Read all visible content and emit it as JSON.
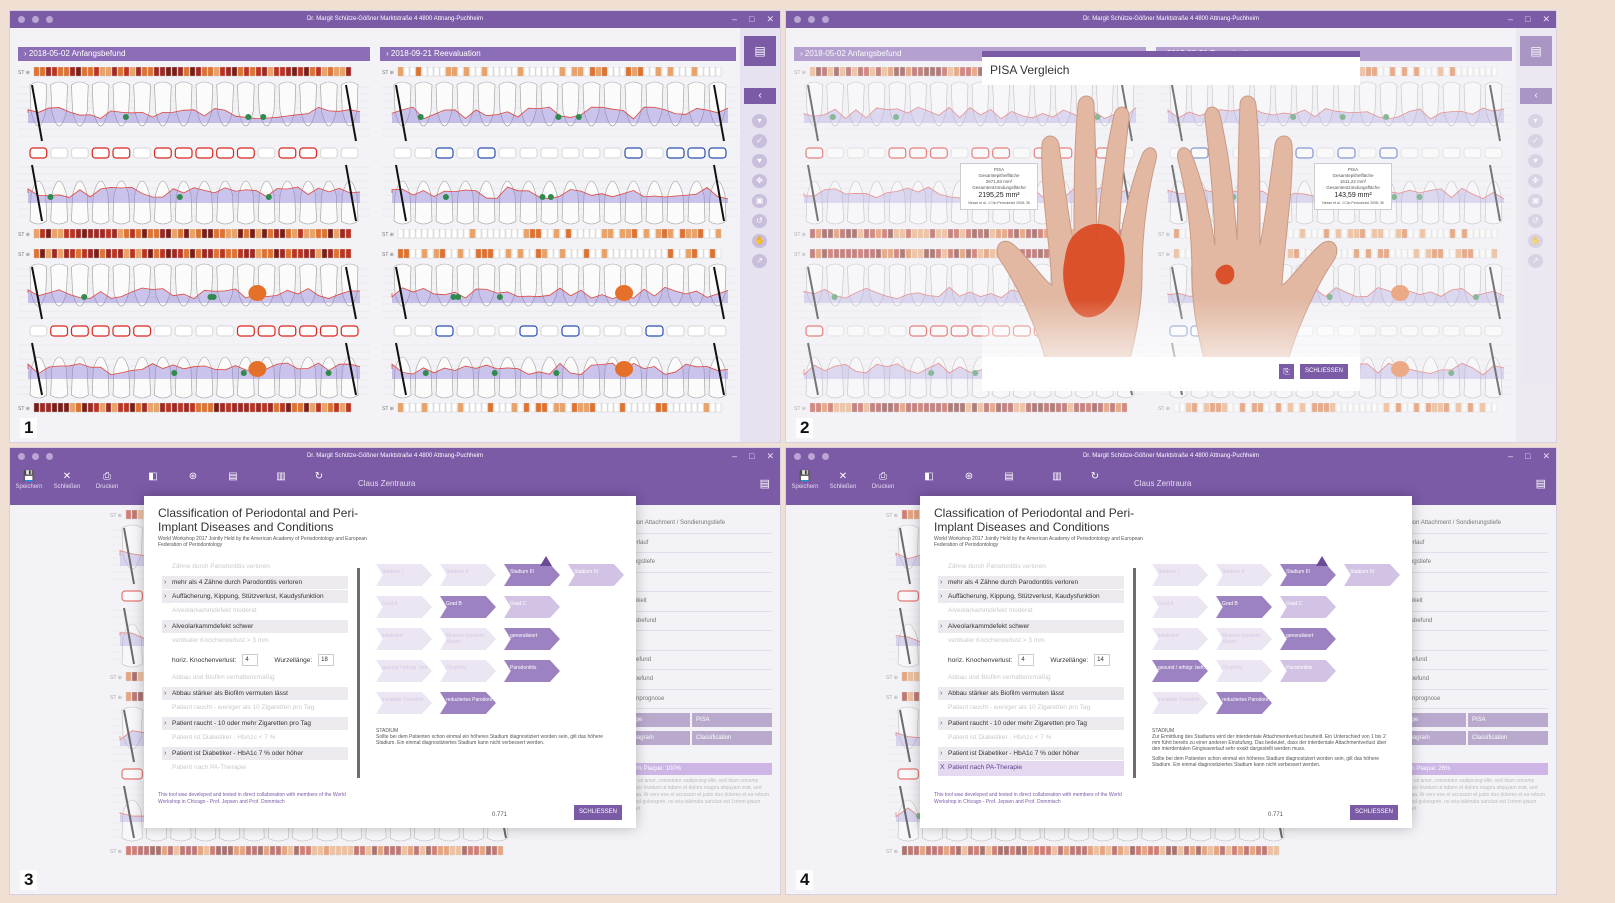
{
  "app": {
    "window_title": "Dr. Margit Schütze-Gößner Marktstraße 4 4800 Attnang-Puchheim",
    "tooth_row_label": "ST ⊕"
  },
  "panel_numbers": [
    "1",
    "2",
    "3",
    "4"
  ],
  "headers": {
    "left": "2018-05-02 Anfangsbefund",
    "right": "2018-09-21 Reevaluation"
  },
  "pisa": {
    "title": "PISA Vergleich",
    "close": "SCHLIESSEN",
    "left_card": {
      "label": "PISA",
      "l1": "Gesamtepithelfläche",
      "v1": "2671,83  mm²",
      "l2": "Gesamtentzündungsfläche",
      "v2": "2195,25 mm²",
      "note": "Nesse et al. J Clin Periodontol 2008; 35"
    },
    "right_card": {
      "label": "PISA",
      "l1": "Gesamtepithelfläche",
      "v1": "1611,22  mm²",
      "l2": "Gesamtentzündungsfläche",
      "v2": "143,59 mm²",
      "note": "Nesse et al. J Clin Periodontol 2008; 35"
    }
  },
  "toolbar": {
    "save": "Speichern",
    "close": "Schließen",
    "print": "Drucken",
    "patient": "Claus Zentraura"
  },
  "side_list": {
    "items": [
      "Kombination Attachment / Sondierungstiefe",
      "Gingivaverlauf",
      "Sondierungstiefe",
      "Blutung",
      "Beweglichkeit",
      "Furkationsbefund",
      "Plaque",
      "Röntgenbefund",
      "Implantatbefund",
      "Einzelzahnprognose"
    ],
    "btn_pathologie": "Pathologie",
    "btn_pisa": "PISA",
    "btn_trend": "Trend Diagram",
    "btn_class": "Classification",
    "bop_3": "BOP: 83% Plaque: 100%",
    "bop_4": "BOP: 9% Plaque: 26%",
    "lorem": "Lorem dolor sit amet, consetetur sadipscing elitr, sed diam nonumy eirmod tempor invidunt ut labore et dolore magna aliquyam erat, sed diam voluptua. At vero eos et accusam et justo duo dolores et ea rebum. Stet clita kasd gubergren, no sea takimata sanctus est Lorem ipsum dolor sit amet."
  },
  "classification": {
    "title": "Classification of Periodontal and Peri-Implant Diseases and Conditions",
    "subtitle": "World Workshop 2017 Jointly Held by the American Academy of Periodontology and European Federation of Periodontology",
    "criteria": [
      "Zähne durch Parodontitis verloren",
      "mehr als 4 Zähne durch Parodontitis verloren",
      "Auffächerung, Kippung, Stützverlust, Kaudysfunktion",
      "Alveolarkammdefekt moderat",
      "Alveolarkammdefekt schwer",
      "vertikaler Knochenverlust > 3 mm",
      "Abbau und Biofilm verhaltensmäßig",
      "Abbau stärker als Biofilm vermuten lässt",
      "Patient raucht - weniger als 10 Zigaretten pro Tag",
      "Patient raucht - 10 oder mehr Zigaretten pro Tag",
      "Patient ist Diabetiker - HbA1c < 7 %",
      "Patient ist Diabetiker - HbA1c 7 % oder höher",
      "Patient nach PA-Therapie"
    ],
    "horiz_label": "horiz. Knochenverlust:",
    "horiz_value": "4",
    "root_label": "Wurzellänge:",
    "root_value_3": "18",
    "root_value_4": "14",
    "grid": {
      "stadium": [
        "Stadium I",
        "Stadium II",
        "Stadium III",
        "Stadium IV"
      ],
      "grad": [
        "Grad A",
        "Grad B",
        "Grad C"
      ],
      "extent": [
        "lokalisiert",
        "Molaren-Inzisiven Muster",
        "generalisiert"
      ],
      "status": [
        "gesund / erfolgr. beh.",
        "Gingivitis",
        "Parodontitis"
      ],
      "reduced": [
        "instabiler Parodont",
        "reduziertes Parodont"
      ]
    },
    "stadium_heading": "STADIUM",
    "note_3": "Sollte bei dem Patienten schon einmal ein höheres Stadium diagnostiziert worden sein, gilt das höhere Stadium. Ein einmal diagnostiziertes Stadium kann nicht verbessert werden.",
    "note_4a": "Zur Ermittlung des Stadiums wird der interdentale Attachmentverlust beurteilt. Ein Unterschied von 1 bis 2 mm führt bereits zu einer anderen Einstufung. Das bedeutet, dass der interdentale Attachmentverlust über den interdentalen Gingivaverlauf sehr exakt dargestellt werden muss.",
    "note_4b": "Sollte bei dem Patienten schon einmal ein höheres Stadium diagnostiziert worden sein, gilt das höhere Stadium. Ein einmal diagnostiziertes Stadium kann nicht verbessert werden.",
    "footer": "This tool was developed and tested in direct collaboration with members of the World Workshop in Chicago - Prof. Jepsen and Prof. Dommisch",
    "score": "0.771",
    "close": "SCHLIESSEN"
  },
  "colors": {
    "brand": "#7b5aa6",
    "accent_orange": "#e5702a",
    "dark_red": "#a32620"
  }
}
